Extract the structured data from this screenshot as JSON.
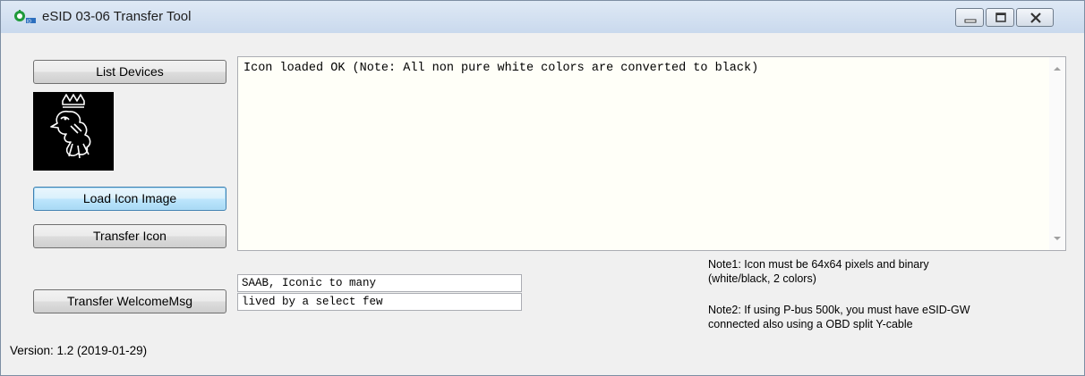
{
  "window": {
    "title": "eSID 03-06 Transfer Tool"
  },
  "buttons": {
    "list_devices": "List Devices",
    "load_icon": "Load Icon Image",
    "transfer_icon": "Transfer Icon",
    "transfer_welcome": "Transfer WelcomeMsg"
  },
  "log": {
    "text": "Icon loaded OK (Note: All non pure white colors are converted to black)"
  },
  "welcome_message": {
    "line1": "SAAB, Iconic to many",
    "line2": "lived by a select few"
  },
  "notes": {
    "note1_line1": "Note1: Icon must be 64x64 pixels and binary",
    "note1_line2": "(white/black, 2 colors)",
    "note2_line1": "Note2: If using P-bus 500k, you must have eSID-GW",
    "note2_line2": "connected also using a OBD split Y-cable"
  },
  "version": "Version: 1.2 (2019-01-29)",
  "icons": {
    "app": "app-icon",
    "preview": "saab-griffin-icon",
    "minimize": "minimize-icon",
    "maximize": "maximize-icon",
    "close": "close-icon"
  },
  "colors": {
    "focus_border": "#3c7fb1",
    "preview_bg": "#000000"
  }
}
